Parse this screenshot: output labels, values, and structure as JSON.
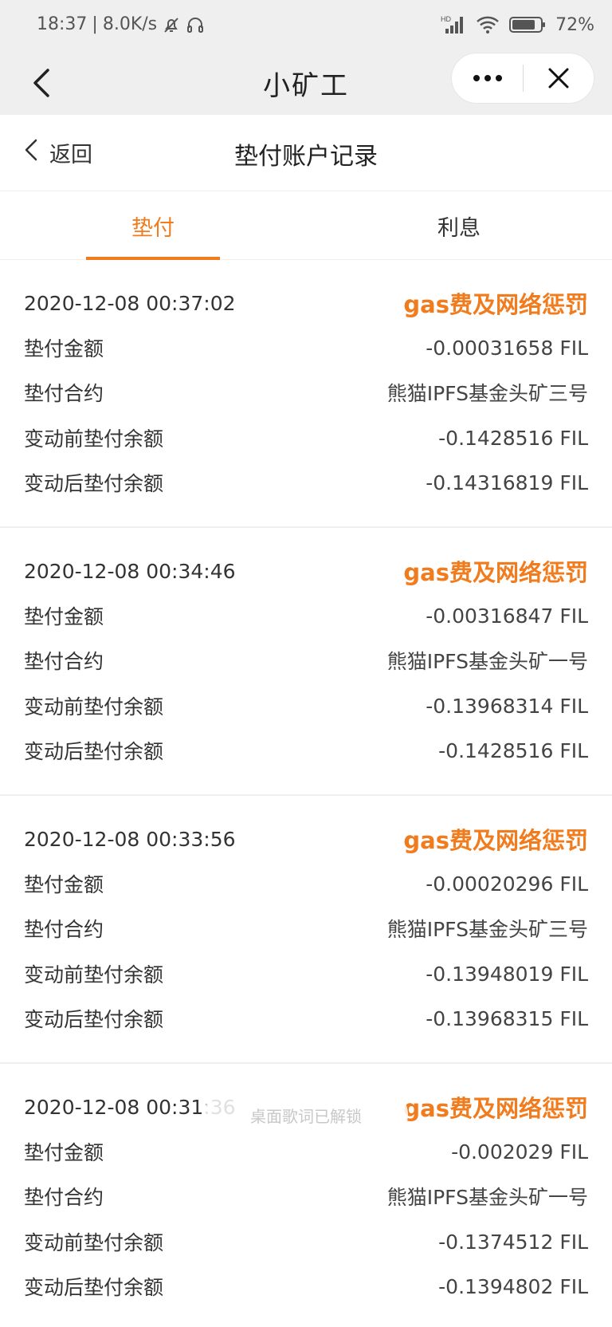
{
  "status_bar": {
    "time": "18:37",
    "separator": "|",
    "net_speed": "8.0K/s",
    "network": "HD",
    "battery": "72%"
  },
  "nav": {
    "title": "小矿工"
  },
  "page": {
    "back_label": "返回",
    "title": "垫付账户记录"
  },
  "tabs": [
    {
      "label": "垫付",
      "active": true
    },
    {
      "label": "利息",
      "active": false
    }
  ],
  "labels": {
    "amount": "垫付金额",
    "contract": "垫付合约",
    "before": "变动前垫付余额",
    "after": "变动后垫付余额"
  },
  "records": [
    {
      "time": "2020-12-08 00:37:02",
      "type": "gas费及网络惩罚",
      "amount": "-0.00031658 FIL",
      "contract": "熊猫IPFS基金头矿三号",
      "before": "-0.1428516 FIL",
      "after": "-0.14316819 FIL"
    },
    {
      "time": "2020-12-08 00:34:46",
      "type": "gas费及网络惩罚",
      "amount": "-0.00316847 FIL",
      "contract": "熊猫IPFS基金头矿一号",
      "before": "-0.13968314 FIL",
      "after": "-0.1428516 FIL"
    },
    {
      "time": "2020-12-08 00:33:56",
      "type": "gas费及网络惩罚",
      "amount": "-0.00020296 FIL",
      "contract": "熊猫IPFS基金头矿三号",
      "before": "-0.13948019 FIL",
      "after": "-0.13968315 FIL"
    },
    {
      "time": "2020-12-08 00:31:36",
      "type": "gas费及网络惩罚",
      "amount": "-0.002029 FIL",
      "contract": "熊猫IPFS基金头矿一号",
      "before": "-0.1374512 FIL",
      "after": "-0.1394802 FIL"
    }
  ],
  "toast": "桌面歌词已解锁",
  "colors": {
    "accent": "#f07c1e",
    "bar_bg": "#efefef"
  },
  "icons": [
    "bell-off-icon",
    "headphones-icon",
    "signal-icon",
    "wifi-icon",
    "battery-icon",
    "back-arrow-icon",
    "more-icon",
    "close-icon",
    "chevron-left-icon"
  ]
}
